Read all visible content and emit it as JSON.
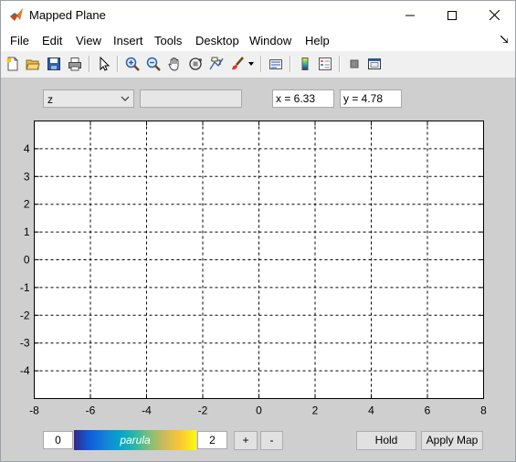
{
  "window": {
    "title": "Mapped Plane"
  },
  "menu": [
    "File",
    "Edit",
    "View",
    "Insert",
    "Tools",
    "Desktop",
    "Window",
    "Help"
  ],
  "toolbar": {
    "buttons": [
      "new-figure-icon",
      "open-file-icon",
      "save-icon",
      "print-icon",
      "edit-plot-arrow-icon",
      "zoom-in-icon",
      "zoom-out-icon",
      "pan-hand-icon",
      "rotate-3d-icon",
      "data-cursor-icon",
      "brush-icon",
      "link-plot-icon",
      "insert-colorbar-icon",
      "insert-legend-icon",
      "hide-plot-tools-icon",
      "show-plot-tools-icon"
    ]
  },
  "controls": {
    "function_select": "z",
    "expression_input": "",
    "x_readout": "x = 6.33",
    "y_readout": "y = 4.78"
  },
  "colormap": {
    "min": "0",
    "name": "parula",
    "max": "2",
    "plus_label": "+",
    "minus_label": "-"
  },
  "buttons": {
    "hold": "Hold",
    "apply_map": "Apply Map"
  },
  "chart_data": {
    "type": "scatter",
    "title": "",
    "xlabel": "",
    "ylabel": "",
    "xlim": [
      -8,
      8
    ],
    "ylim": [
      -5,
      5
    ],
    "x_ticks": [
      "-8",
      "-6",
      "-4",
      "-2",
      "0",
      "2",
      "4",
      "6",
      "8"
    ],
    "y_ticks": [
      "4",
      "3",
      "2",
      "1",
      "0",
      "-1",
      "-2",
      "-3",
      "-4"
    ],
    "grid": true,
    "grid_style": "dashed",
    "series": []
  }
}
